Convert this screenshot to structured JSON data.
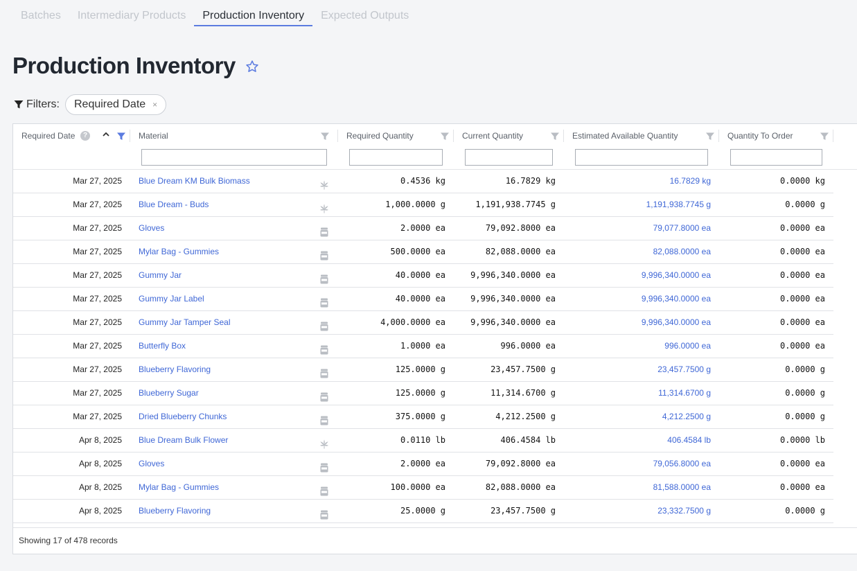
{
  "tabs": [
    {
      "label": "Batches",
      "active": false
    },
    {
      "label": "Intermediary Products",
      "active": false
    },
    {
      "label": "Production Inventory",
      "active": true
    },
    {
      "label": "Expected Outputs",
      "active": false
    }
  ],
  "page": {
    "title": "Production Inventory"
  },
  "filters": {
    "label": "Filters:",
    "chip_label": "Required Date",
    "chip_remove": "×"
  },
  "table": {
    "columns": {
      "required_date": "Required Date",
      "help": "?",
      "material": "Material",
      "required_quantity": "Required Quantity",
      "current_quantity": "Current Quantity",
      "estimated_available_quantity": "Estimated Available Quantity",
      "quantity_to_order": "Quantity To Order"
    },
    "rows": [
      {
        "date": "Mar 27, 2025",
        "material": "Blue Dream KM Bulk Biomass",
        "type": "cannabis-leaf-icon",
        "req": "0.4536 kg",
        "cur": "16.7829 kg",
        "est": "16.7829 kg",
        "ord": "0.0000 kg"
      },
      {
        "date": "Mar 27, 2025",
        "material": "Blue Dream - Buds",
        "type": "cannabis-leaf-icon",
        "req": "1,000.0000 g",
        "cur": "1,191,938.7745 g",
        "est": "1,191,938.7745 g",
        "ord": "0.0000 g"
      },
      {
        "date": "Mar 27, 2025",
        "material": "Gloves",
        "type": "supply-jar-icon",
        "req": "2.0000 ea",
        "cur": "79,092.8000 ea",
        "est": "79,077.8000 ea",
        "ord": "0.0000 ea"
      },
      {
        "date": "Mar 27, 2025",
        "material": "Mylar Bag - Gummies",
        "type": "supply-jar-icon",
        "req": "500.0000 ea",
        "cur": "82,088.0000 ea",
        "est": "82,088.0000 ea",
        "ord": "0.0000 ea"
      },
      {
        "date": "Mar 27, 2025",
        "material": "Gummy Jar",
        "type": "supply-jar-icon",
        "req": "40.0000 ea",
        "cur": "9,996,340.0000 ea",
        "est": "9,996,340.0000 ea",
        "ord": "0.0000 ea"
      },
      {
        "date": "Mar 27, 2025",
        "material": "Gummy Jar Label",
        "type": "supply-jar-icon",
        "req": "40.0000 ea",
        "cur": "9,996,340.0000 ea",
        "est": "9,996,340.0000 ea",
        "ord": "0.0000 ea"
      },
      {
        "date": "Mar 27, 2025",
        "material": "Gummy Jar Tamper Seal",
        "type": "supply-jar-icon",
        "req": "4,000.0000 ea",
        "cur": "9,996,340.0000 ea",
        "est": "9,996,340.0000 ea",
        "ord": "0.0000 ea"
      },
      {
        "date": "Mar 27, 2025",
        "material": "Butterfly Box",
        "type": "supply-jar-icon",
        "req": "1.0000 ea",
        "cur": "996.0000 ea",
        "est": "996.0000 ea",
        "ord": "0.0000 ea"
      },
      {
        "date": "Mar 27, 2025",
        "material": "Blueberry Flavoring",
        "type": "supply-jar-icon",
        "req": "125.0000 g",
        "cur": "23,457.7500 g",
        "est": "23,457.7500 g",
        "ord": "0.0000 g"
      },
      {
        "date": "Mar 27, 2025",
        "material": "Blueberry Sugar",
        "type": "supply-jar-icon",
        "req": "125.0000 g",
        "cur": "11,314.6700 g",
        "est": "11,314.6700 g",
        "ord": "0.0000 g"
      },
      {
        "date": "Mar 27, 2025",
        "material": "Dried Blueberry Chunks",
        "type": "supply-jar-icon",
        "req": "375.0000 g",
        "cur": "4,212.2500 g",
        "est": "4,212.2500 g",
        "ord": "0.0000 g"
      },
      {
        "date": "Apr 8, 2025",
        "material": "Blue Dream Bulk Flower",
        "type": "cannabis-leaf-icon",
        "req": "0.0110 lb",
        "cur": "406.4584 lb",
        "est": "406.4584 lb",
        "ord": "0.0000 lb"
      },
      {
        "date": "Apr 8, 2025",
        "material": "Gloves",
        "type": "supply-jar-icon",
        "req": "2.0000 ea",
        "cur": "79,092.8000 ea",
        "est": "79,056.8000 ea",
        "ord": "0.0000 ea"
      },
      {
        "date": "Apr 8, 2025",
        "material": "Mylar Bag - Gummies",
        "type": "supply-jar-icon",
        "req": "100.0000 ea",
        "cur": "82,088.0000 ea",
        "est": "81,588.0000 ea",
        "ord": "0.0000 ea"
      },
      {
        "date": "Apr 8, 2025",
        "material": "Blueberry Flavoring",
        "type": "supply-jar-icon",
        "req": "25.0000 g",
        "cur": "23,457.7500 g",
        "est": "23,332.7500 g",
        "ord": "0.0000 g"
      },
      {
        "date": "",
        "material": "",
        "type": "supply-jar-icon",
        "req": "",
        "cur": "",
        "est": "",
        "ord": ""
      }
    ]
  },
  "footer": {
    "text": "Showing 17 of 478 records"
  },
  "colors": {
    "accent": "#5b7be0",
    "link": "#3f67d6"
  }
}
